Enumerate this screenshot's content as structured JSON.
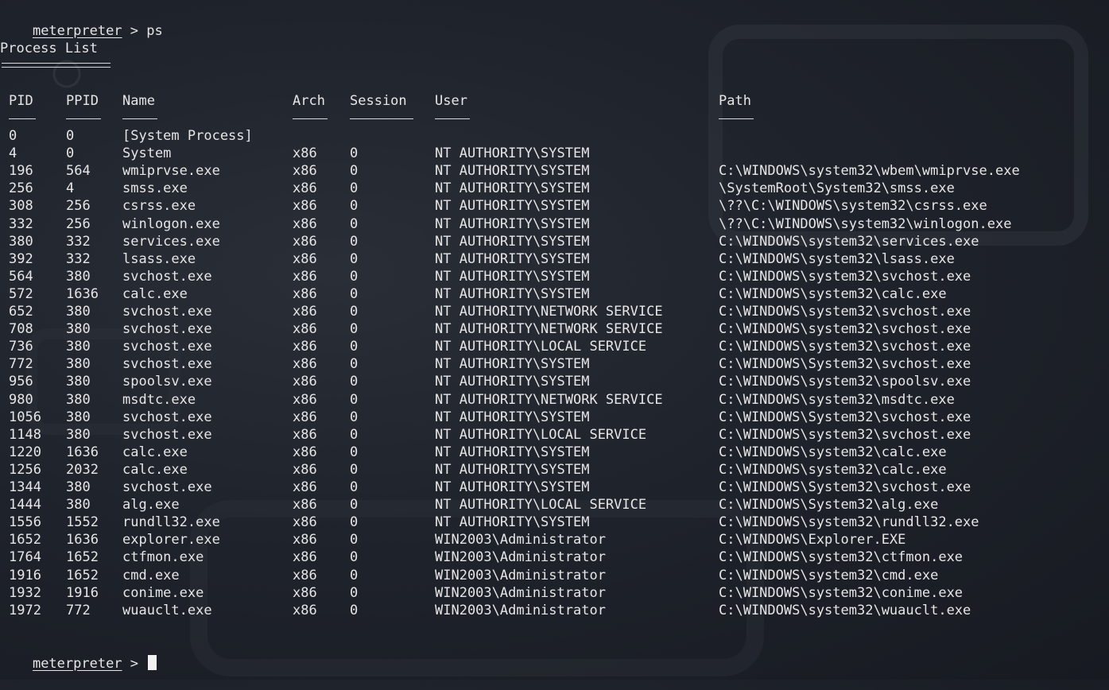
{
  "prompt": {
    "word": "meterpreter",
    "separator": " > ",
    "command": "ps"
  },
  "section_title": "Process List",
  "columns": {
    "pid": "PID",
    "ppid": "PPID",
    "name": "Name",
    "arch": "Arch",
    "session": "Session",
    "user": "User",
    "path": "Path"
  },
  "processes": [
    {
      "pid": "0",
      "ppid": "0",
      "name": "[System Process]",
      "arch": "",
      "session": "",
      "user": "",
      "path": ""
    },
    {
      "pid": "4",
      "ppid": "0",
      "name": "System",
      "arch": "x86",
      "session": "0",
      "user": "NT AUTHORITY\\SYSTEM",
      "path": ""
    },
    {
      "pid": "196",
      "ppid": "564",
      "name": "wmiprvse.exe",
      "arch": "x86",
      "session": "0",
      "user": "NT AUTHORITY\\SYSTEM",
      "path": "C:\\WINDOWS\\system32\\wbem\\wmiprvse.exe"
    },
    {
      "pid": "256",
      "ppid": "4",
      "name": "smss.exe",
      "arch": "x86",
      "session": "0",
      "user": "NT AUTHORITY\\SYSTEM",
      "path": "\\SystemRoot\\System32\\smss.exe"
    },
    {
      "pid": "308",
      "ppid": "256",
      "name": "csrss.exe",
      "arch": "x86",
      "session": "0",
      "user": "NT AUTHORITY\\SYSTEM",
      "path": "\\??\\C:\\WINDOWS\\system32\\csrss.exe"
    },
    {
      "pid": "332",
      "ppid": "256",
      "name": "winlogon.exe",
      "arch": "x86",
      "session": "0",
      "user": "NT AUTHORITY\\SYSTEM",
      "path": "\\??\\C:\\WINDOWS\\system32\\winlogon.exe"
    },
    {
      "pid": "380",
      "ppid": "332",
      "name": "services.exe",
      "arch": "x86",
      "session": "0",
      "user": "NT AUTHORITY\\SYSTEM",
      "path": "C:\\WINDOWS\\system32\\services.exe"
    },
    {
      "pid": "392",
      "ppid": "332",
      "name": "lsass.exe",
      "arch": "x86",
      "session": "0",
      "user": "NT AUTHORITY\\SYSTEM",
      "path": "C:\\WINDOWS\\system32\\lsass.exe"
    },
    {
      "pid": "564",
      "ppid": "380",
      "name": "svchost.exe",
      "arch": "x86",
      "session": "0",
      "user": "NT AUTHORITY\\SYSTEM",
      "path": "C:\\WINDOWS\\system32\\svchost.exe"
    },
    {
      "pid": "572",
      "ppid": "1636",
      "name": "calc.exe",
      "arch": "x86",
      "session": "0",
      "user": "NT AUTHORITY\\SYSTEM",
      "path": "C:\\WINDOWS\\system32\\calc.exe"
    },
    {
      "pid": "652",
      "ppid": "380",
      "name": "svchost.exe",
      "arch": "x86",
      "session": "0",
      "user": "NT AUTHORITY\\NETWORK SERVICE",
      "path": "C:\\WINDOWS\\system32\\svchost.exe"
    },
    {
      "pid": "708",
      "ppid": "380",
      "name": "svchost.exe",
      "arch": "x86",
      "session": "0",
      "user": "NT AUTHORITY\\NETWORK SERVICE",
      "path": "C:\\WINDOWS\\system32\\svchost.exe"
    },
    {
      "pid": "736",
      "ppid": "380",
      "name": "svchost.exe",
      "arch": "x86",
      "session": "0",
      "user": "NT AUTHORITY\\LOCAL SERVICE",
      "path": "C:\\WINDOWS\\system32\\svchost.exe"
    },
    {
      "pid": "772",
      "ppid": "380",
      "name": "svchost.exe",
      "arch": "x86",
      "session": "0",
      "user": "NT AUTHORITY\\SYSTEM",
      "path": "C:\\WINDOWS\\System32\\svchost.exe"
    },
    {
      "pid": "956",
      "ppid": "380",
      "name": "spoolsv.exe",
      "arch": "x86",
      "session": "0",
      "user": "NT AUTHORITY\\SYSTEM",
      "path": "C:\\WINDOWS\\system32\\spoolsv.exe"
    },
    {
      "pid": "980",
      "ppid": "380",
      "name": "msdtc.exe",
      "arch": "x86",
      "session": "0",
      "user": "NT AUTHORITY\\NETWORK SERVICE",
      "path": "C:\\WINDOWS\\system32\\msdtc.exe"
    },
    {
      "pid": "1056",
      "ppid": "380",
      "name": "svchost.exe",
      "arch": "x86",
      "session": "0",
      "user": "NT AUTHORITY\\SYSTEM",
      "path": "C:\\WINDOWS\\System32\\svchost.exe"
    },
    {
      "pid": "1148",
      "ppid": "380",
      "name": "svchost.exe",
      "arch": "x86",
      "session": "0",
      "user": "NT AUTHORITY\\LOCAL SERVICE",
      "path": "C:\\WINDOWS\\system32\\svchost.exe"
    },
    {
      "pid": "1220",
      "ppid": "1636",
      "name": "calc.exe",
      "arch": "x86",
      "session": "0",
      "user": "NT AUTHORITY\\SYSTEM",
      "path": "C:\\WINDOWS\\system32\\calc.exe"
    },
    {
      "pid": "1256",
      "ppid": "2032",
      "name": "calc.exe",
      "arch": "x86",
      "session": "0",
      "user": "NT AUTHORITY\\SYSTEM",
      "path": "C:\\WINDOWS\\system32\\calc.exe"
    },
    {
      "pid": "1344",
      "ppid": "380",
      "name": "svchost.exe",
      "arch": "x86",
      "session": "0",
      "user": "NT AUTHORITY\\SYSTEM",
      "path": "C:\\WINDOWS\\System32\\svchost.exe"
    },
    {
      "pid": "1444",
      "ppid": "380",
      "name": "alg.exe",
      "arch": "x86",
      "session": "0",
      "user": "NT AUTHORITY\\LOCAL SERVICE",
      "path": "C:\\WINDOWS\\System32\\alg.exe"
    },
    {
      "pid": "1556",
      "ppid": "1552",
      "name": "rundll32.exe",
      "arch": "x86",
      "session": "0",
      "user": "NT AUTHORITY\\SYSTEM",
      "path": "C:\\WINDOWS\\system32\\rundll32.exe"
    },
    {
      "pid": "1652",
      "ppid": "1636",
      "name": "explorer.exe",
      "arch": "x86",
      "session": "0",
      "user": "WIN2003\\Administrator",
      "path": "C:\\WINDOWS\\Explorer.EXE"
    },
    {
      "pid": "1764",
      "ppid": "1652",
      "name": "ctfmon.exe",
      "arch": "x86",
      "session": "0",
      "user": "WIN2003\\Administrator",
      "path": "C:\\WINDOWS\\system32\\ctfmon.exe"
    },
    {
      "pid": "1916",
      "ppid": "1652",
      "name": "cmd.exe",
      "arch": "x86",
      "session": "0",
      "user": "WIN2003\\Administrator",
      "path": "C:\\WINDOWS\\system32\\cmd.exe"
    },
    {
      "pid": "1932",
      "ppid": "1916",
      "name": "conime.exe",
      "arch": "x86",
      "session": "0",
      "user": "WIN2003\\Administrator",
      "path": "C:\\WINDOWS\\system32\\conime.exe"
    },
    {
      "pid": "1972",
      "ppid": "772",
      "name": "wuauclt.exe",
      "arch": "x86",
      "session": "0",
      "user": "WIN2003\\Administrator",
      "path": "C:\\WINDOWS\\system32\\wuauclt.exe"
    }
  ],
  "final_prompt": {
    "word": "meterpreter",
    "separator": " > "
  }
}
